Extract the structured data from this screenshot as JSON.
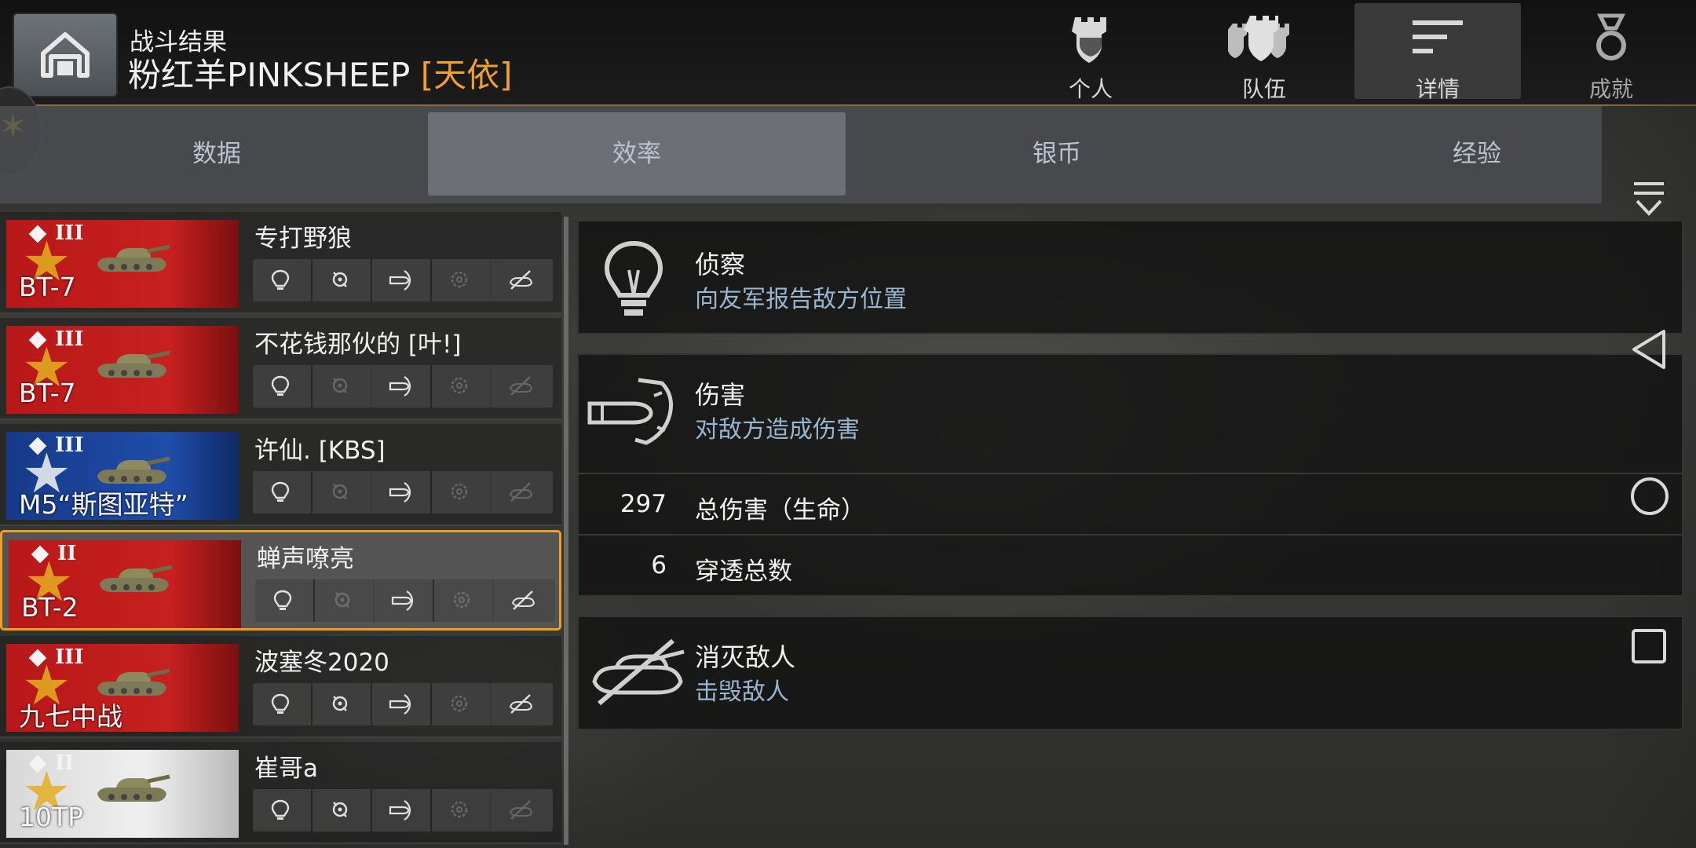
{
  "header": {
    "title": "战斗结果",
    "player_name": "粉红羊PINKSHEEP",
    "player_clan": "[天依]"
  },
  "top_tabs": [
    {
      "label": "个人",
      "icon": "personal-icon"
    },
    {
      "label": "队伍",
      "icon": "team-icon"
    },
    {
      "label": "详情",
      "icon": "details-icon",
      "active": true
    },
    {
      "label": "成就",
      "icon": "medal-icon"
    }
  ],
  "sub_tabs": [
    {
      "label": "数据"
    },
    {
      "label": "效率",
      "active": true
    },
    {
      "label": "银币"
    },
    {
      "label": "经验"
    }
  ],
  "players": [
    {
      "name": "专打野狼",
      "vehicle": "BT-7",
      "tier": "III",
      "nation": "ussr",
      "icons_active": [
        true,
        true,
        true,
        false,
        true
      ]
    },
    {
      "name": "不花钱那伙的 [叶!]",
      "vehicle": "BT-7",
      "tier": "III",
      "nation": "ussr",
      "icons_active": [
        true,
        false,
        true,
        false,
        false
      ]
    },
    {
      "name": "许仙. [KBS]",
      "vehicle": "M5“斯图亚特”",
      "tier": "III",
      "nation": "usa",
      "icons_active": [
        true,
        false,
        true,
        false,
        false
      ]
    },
    {
      "name": "蝉声嘹亮",
      "vehicle": "BT-2",
      "tier": "II",
      "nation": "ussr",
      "selected": true,
      "icons_active": [
        true,
        false,
        true,
        false,
        true
      ]
    },
    {
      "name": "波塞冬2020",
      "vehicle": "九七中战",
      "tier": "III",
      "nation": "japan",
      "icons_active": [
        true,
        true,
        true,
        false,
        true
      ]
    },
    {
      "name": "崔哥a",
      "vehicle": "10TP",
      "tier": "II",
      "nation": "poland",
      "icons_active": [
        true,
        true,
        true,
        false,
        false
      ]
    }
  ],
  "details": {
    "spotting": {
      "title": "侦察",
      "subtitle": "向友军报告敌方位置",
      "icon": "spotting-lightbulb-icon"
    },
    "damage": {
      "title": "伤害",
      "subtitle": "对敌方造成伤害",
      "icon": "damage-shell-icon",
      "stats": [
        {
          "value": "297",
          "label": "总伤害（生命）"
        },
        {
          "value": "6",
          "label": "穿透总数"
        }
      ]
    },
    "kills": {
      "title": "消灭敌人",
      "subtitle": "击毁敌人",
      "icon": "destroyed-tank-icon"
    }
  },
  "colors": {
    "accent": "#f0a030",
    "selected_border": "#f0a020",
    "subtitle": "#98b6cf"
  }
}
